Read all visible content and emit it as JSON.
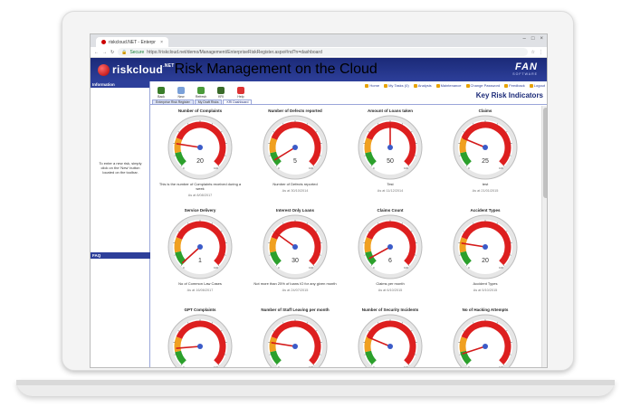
{
  "browser": {
    "tab_title": "riskcloud.NET - Enterpr",
    "tab_close": "×",
    "window_buttons": [
      "–",
      "□",
      "×"
    ],
    "secure_label": "Secure",
    "url": "https://riskcloud.net/demo/Management/EnterpriseRiskRegister.aspx#/nd?n=dashboard"
  },
  "app": {
    "logo": "riskcloud",
    "logo_suffix": ".NET",
    "tagline": "Risk Management on the Cloud",
    "brand": "FAN",
    "brand_sub": "SOFTWARE",
    "page_title": "Key Risk Indicators"
  },
  "sidebar": {
    "info_heading": "Information",
    "info_text": "To enter a new risk, simply click on the 'New' button located on the toolbar.",
    "faq_heading": "FAQ"
  },
  "toolbar": [
    {
      "label": "Back",
      "color": "#3a7d2a"
    },
    {
      "label": "New",
      "color": "#7aa0d8"
    },
    {
      "label": "Refresh",
      "color": "#4a9a3a"
    },
    {
      "label": "KRI",
      "color": "#3a6a2a"
    },
    {
      "label": "Help",
      "color": "#d33"
    }
  ],
  "top_links": [
    "Home",
    "My Tasks (0)",
    "Analysis",
    "Maintenance",
    "Change Password",
    "Feedback",
    "Logout"
  ],
  "subtabs": [
    {
      "label": "Enterprise Risk Register",
      "active": false
    },
    {
      "label": "My Draft Risks",
      "active": false
    },
    {
      "label": "KRI Dashboard",
      "active": true
    }
  ],
  "gauges": [
    {
      "title": "Number of Complaints",
      "value": "20",
      "fraction": 0.2,
      "desc": "This is the number of Complaints received during a week",
      "date": "As at 8/08/2017"
    },
    {
      "title": "Number of Defects reported",
      "value": "5",
      "fraction": 0.05,
      "desc": "Number of Defects reported",
      "date": "As at 30/10/2014"
    },
    {
      "title": "Amount of Loans taken",
      "value": "50",
      "fraction": 0.5,
      "desc": "Test",
      "date": "As at 11/12/2014"
    },
    {
      "title": "Claims",
      "value": "25",
      "fraction": 0.25,
      "desc": "test",
      "date": "As at 21/01/2015"
    },
    {
      "title": "Service Delivery",
      "value": "1",
      "fraction": 0.01,
      "desc": "No of Common Law Cases",
      "date": "As at 16/06/2017"
    },
    {
      "title": "Interest Only Loans",
      "value": "30",
      "fraction": 0.3,
      "desc": "Not more than 25% of loans IO for any given month",
      "date": "As at 24/07/2015"
    },
    {
      "title": "Claims Count",
      "value": "6",
      "fraction": 0.06,
      "desc": "Claims per month",
      "date": "As at 6/10/2015"
    },
    {
      "title": "Accident Types",
      "value": "20",
      "fraction": 0.2,
      "desc": "Accident Types",
      "date": "As at 5/10/2015"
    },
    {
      "title": "GPT Complaints",
      "value": "",
      "fraction": 0.15,
      "desc": "",
      "date": ""
    },
    {
      "title": "Number of Staff Leaving per month",
      "value": "",
      "fraction": 0.2,
      "desc": "",
      "date": ""
    },
    {
      "title": "Number of Security Incidents",
      "value": "",
      "fraction": 0.25,
      "desc": "",
      "date": ""
    },
    {
      "title": "No of Hacking Attempts",
      "value": "",
      "fraction": 0.1,
      "desc": "",
      "date": ""
    }
  ],
  "gauge_scale": {
    "min": "0",
    "max": "100"
  },
  "colors": {
    "banner": "#2d3f9a",
    "red": "#dd1f1f",
    "orange": "#f0a020",
    "green": "#2ca02c",
    "needle": "#d41a1a",
    "pivot": "#3b5bc8"
  }
}
